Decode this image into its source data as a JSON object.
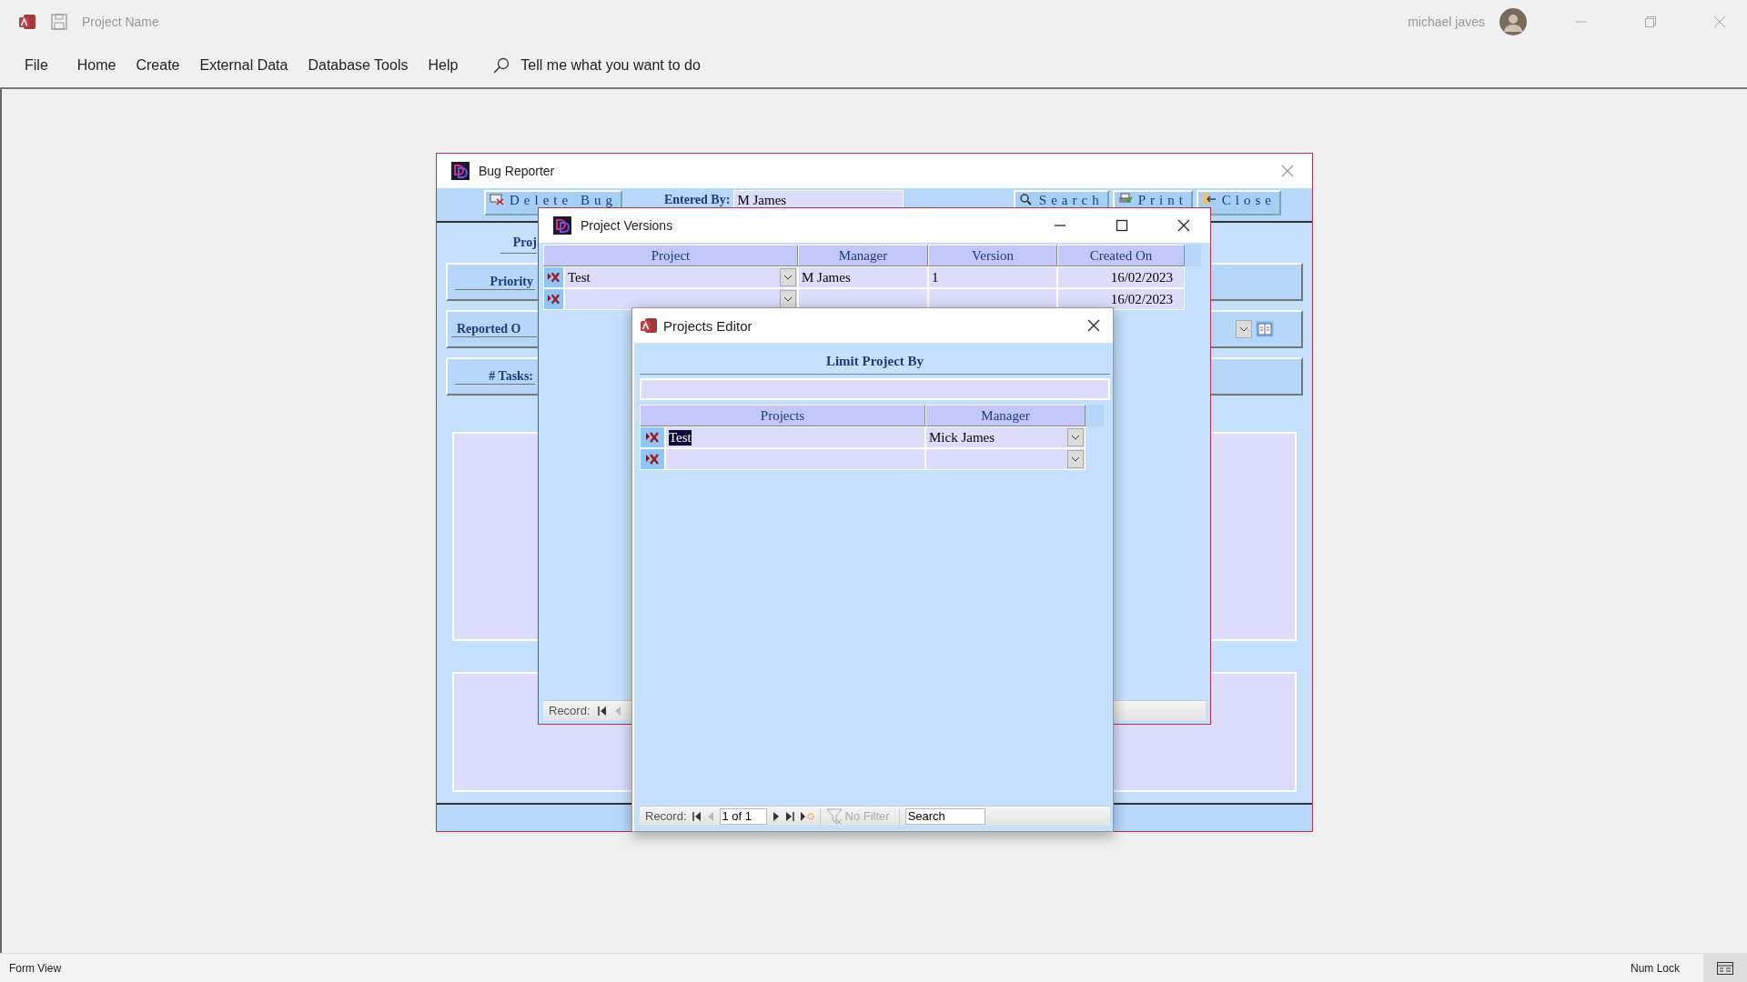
{
  "app": {
    "title": "Project Name",
    "user": "michael javes",
    "tell_me": "Tell me what you want to do",
    "menu": [
      {
        "label": "File"
      },
      {
        "label": "Home"
      },
      {
        "label": "Create"
      },
      {
        "label": "External Data"
      },
      {
        "label": "Database Tools"
      },
      {
        "label": "Help"
      }
    ]
  },
  "bug_reporter": {
    "title": "Bug Reporter",
    "delete_button": "Delete Bug",
    "entered_by_label": "Entered By:",
    "entered_by_value": "M James",
    "buttons": [
      {
        "label": "Search",
        "kind": "search"
      },
      {
        "label": "Print",
        "kind": "print"
      },
      {
        "label": "Close",
        "kind": "close"
      }
    ],
    "project_label": "Proj",
    "panels": [
      {
        "label": "Priority",
        "kind": "plain"
      },
      {
        "label": "Reported O",
        "kind": "date"
      },
      {
        "label": "# Tasks:",
        "kind": "plain"
      }
    ]
  },
  "project_versions": {
    "title": "Project Versions",
    "columns": [
      "Project",
      "Manager",
      "Version",
      "Created On"
    ],
    "rows": [
      {
        "project": "Test",
        "manager": "M James",
        "version": "1",
        "created_on": "16/02/2023"
      },
      {
        "created_on": "16/02/2023"
      }
    ],
    "record_label": "Record:"
  },
  "projects_editor": {
    "title": "Projects Editor",
    "heading": "Limit Project By",
    "columns": [
      "Projects",
      "Manager"
    ],
    "rows": [
      {
        "project": "Test",
        "manager": "Mick James",
        "selected": true
      },
      {
        "selected": false
      }
    ],
    "navigation": {
      "record_label": "Record:",
      "position": "1 of 1",
      "filter": "No Filter",
      "search_placeholder": "Search"
    }
  },
  "status_bar": {
    "view": "Form View",
    "num_lock": "Num Lock"
  }
}
